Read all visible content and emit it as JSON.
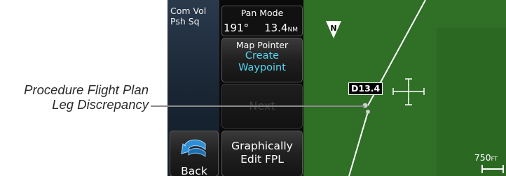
{
  "callout": {
    "line1": "Procedure Flight Plan",
    "line2": "Leg Discrepancy"
  },
  "sidebar": {
    "comvol_line1": "Com Vol",
    "comvol_line2": "Psh Sq",
    "back_label": "Back"
  },
  "pan_mode": {
    "title": "Pan Mode",
    "bearing": "191°",
    "distance": "13.4",
    "distance_unit": "NM"
  },
  "buttons": {
    "map_pointer_title": "Map Pointer",
    "map_pointer_line1": "Create",
    "map_pointer_line2": "Waypoint",
    "next_label": "Next",
    "graphically_line1": "Graphically",
    "graphically_line2": "Edit FPL"
  },
  "map": {
    "north_label": "N",
    "discrepancy_label": "D13.4",
    "scale_value": "750",
    "scale_unit": "FT",
    "colors": {
      "terrain": "#2f6f26",
      "accent": "#55d6f0"
    }
  }
}
